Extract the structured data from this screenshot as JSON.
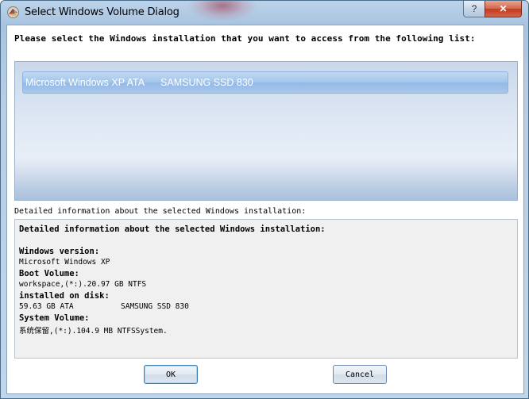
{
  "window": {
    "title": "Select Windows Volume Dialog",
    "help_glyph": "?",
    "close_glyph": "✕"
  },
  "prompt": "Please select the Windows installation that you want to access from the following list:",
  "list": {
    "items": [
      {
        "name": "Microsoft Windows XP ATA",
        "disk": "SAMSUNG SSD 830",
        "selected": true
      }
    ]
  },
  "details": {
    "label": "Detailed information about the selected Windows installation:",
    "heading": "Detailed information about the selected Windows installation:",
    "windows_version_label": "Windows version:",
    "windows_version_value": "Microsoft Windows XP",
    "boot_volume_label": "Boot Volume:",
    "boot_volume_value": "workspace,(*:).20.97 GB NTFS",
    "installed_on_disk_label": "installed on disk:",
    "installed_on_disk_size": "59.63 GB ATA",
    "installed_on_disk_model": "SAMSUNG SSD 830",
    "system_volume_label": "System Volume:",
    "system_volume_value": "系统保留,(*:).104.9 MB NTFSSystem."
  },
  "buttons": {
    "ok": "OK",
    "cancel": "Cancel"
  },
  "icons": {
    "app": "app-icon",
    "help": "help-icon",
    "close": "close-icon"
  }
}
